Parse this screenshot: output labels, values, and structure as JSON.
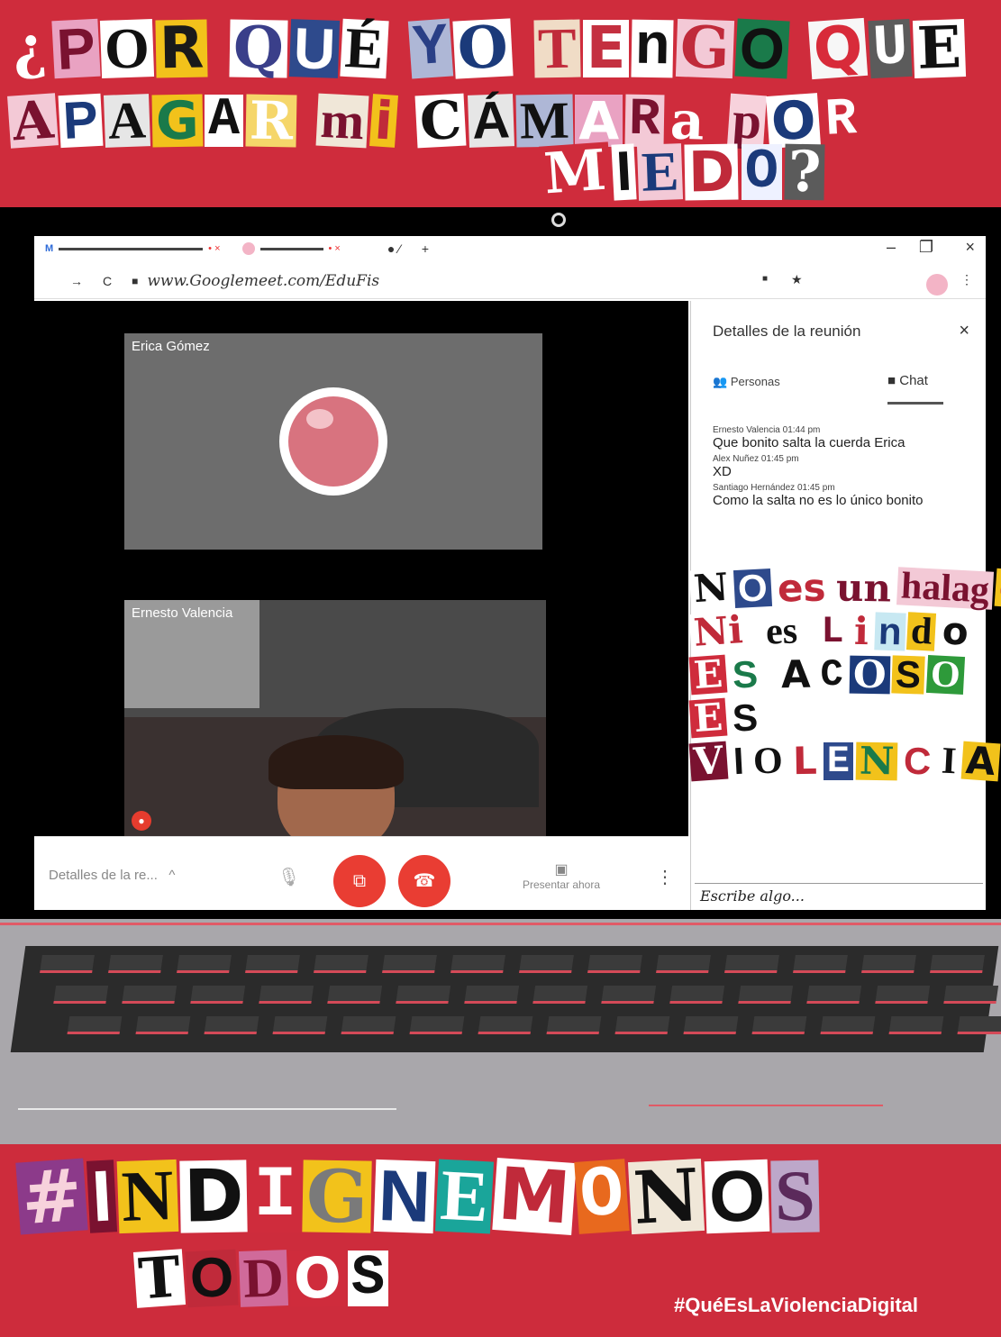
{
  "headline": {
    "line1": [
      {
        "t": "¿",
        "bg": "#cf2c3c",
        "fg": "#fff"
      },
      {
        "t": "P",
        "bg": "#e9a2c2",
        "fg": "#7a1230"
      },
      {
        "t": "O",
        "bg": "#fff",
        "fg": "#111"
      },
      {
        "t": "R",
        "bg": "#f2c21b",
        "fg": "#1a1a1a"
      },
      {
        "t": " "
      },
      {
        "t": "Q",
        "bg": "#fff",
        "fg": "#3a3f8a"
      },
      {
        "t": "U",
        "bg": "#2e4a8c",
        "fg": "#fff"
      },
      {
        "t": "É",
        "bg": "#fff",
        "fg": "#111"
      },
      {
        "t": " "
      },
      {
        "t": "Y",
        "bg": "#aeb7d6",
        "fg": "#2a3f86"
      },
      {
        "t": "O",
        "bg": "#fff",
        "fg": "#1b3a7a"
      },
      {
        "t": " "
      },
      {
        "t": "T",
        "bg": "#f0dcc6",
        "fg": "#c02a3a"
      },
      {
        "t": "E",
        "bg": "#fff",
        "fg": "#c43040"
      },
      {
        "t": "n",
        "bg": "#fff",
        "fg": "#111"
      },
      {
        "t": "G",
        "bg": "#f3c9d6",
        "fg": "#c02a3a"
      },
      {
        "t": "O",
        "bg": "#1a7a4a",
        "fg": "#111"
      },
      {
        "t": " "
      },
      {
        "t": "Q",
        "bg": "#f7f7f7",
        "fg": "#d82b3a"
      },
      {
        "t": "U",
        "bg": "#5b5b5b",
        "fg": "#fff"
      },
      {
        "t": "E",
        "bg": "#fff",
        "fg": "#111"
      }
    ],
    "line2": [
      {
        "t": "A",
        "bg": "#f3c9d6",
        "fg": "#7a1230"
      },
      {
        "t": "P",
        "bg": "#fff",
        "fg": "#1b3a7a"
      },
      {
        "t": "A",
        "bg": "#e6e6e6",
        "fg": "#111"
      },
      {
        "t": "G",
        "bg": "#f2c21b",
        "fg": "#1a7a4a"
      },
      {
        "t": "A",
        "bg": "#fff",
        "fg": "#111"
      },
      {
        "t": "R",
        "bg": "#f5d66a",
        "fg": "#fff"
      },
      {
        "t": " "
      },
      {
        "t": "m",
        "bg": "#f0e7d8",
        "fg": "#7a1230"
      },
      {
        "t": "i",
        "bg": "#f2c21b",
        "fg": "#c02a3a"
      },
      {
        "t": " "
      },
      {
        "t": "C",
        "bg": "#fff",
        "fg": "#111"
      },
      {
        "t": "Á",
        "bg": "#e6e6e6",
        "fg": "#111"
      },
      {
        "t": "M",
        "bg": "#aeb7d6",
        "fg": "#111"
      },
      {
        "t": "A",
        "bg": "#e9a2c2",
        "fg": "#fff"
      },
      {
        "t": "R",
        "bg": "#f3c9d6",
        "fg": "#7a1230"
      },
      {
        "t": "a",
        "bg": "#cf2c3c",
        "fg": "#fff"
      },
      {
        "t": " "
      },
      {
        "t": "p",
        "bg": "#f7d2dc",
        "fg": "#7a1230"
      },
      {
        "t": "O",
        "bg": "#fff",
        "fg": "#1b3a7a"
      },
      {
        "t": "R",
        "bg": "#cf2c3c",
        "fg": "#fff"
      }
    ],
    "line3": [
      {
        "t": "M",
        "bg": "#cf2c3c",
        "fg": "#fff"
      },
      {
        "t": "I",
        "bg": "#fff",
        "fg": "#111"
      },
      {
        "t": "E",
        "bg": "#f3c9d6",
        "fg": "#1b3a7a"
      },
      {
        "t": "D",
        "bg": "#fff",
        "fg": "#c02a3a"
      },
      {
        "t": "O",
        "bg": "#eef1ff",
        "fg": "#1b3a7a"
      },
      {
        "t": "?",
        "bg": "#5b5b5b",
        "fg": "#fff"
      }
    ]
  },
  "browser": {
    "tab1": "M",
    "url": "www.Googlemeet.com/EduFis",
    "controls": {
      "minimize": "–",
      "maximize": "❐",
      "close": "×"
    },
    "nav": {
      "forward": "→",
      "reload": "C",
      "lock": "🔒",
      "share": "■",
      "star": "★",
      "menu": "⋮"
    }
  },
  "meet": {
    "participants": [
      {
        "name": "Erica Gómez"
      },
      {
        "name": "Ernesto Valencia"
      }
    ],
    "controls": {
      "details": "Detalles de la re...",
      "details_caret": "^",
      "mic": "🎙",
      "camera": "⧉",
      "hangup": "☎",
      "present": "Presentar ahora",
      "more": "⋮"
    }
  },
  "panel": {
    "title": "Detalles de la reunión",
    "close": "×",
    "tab_people": "Personas",
    "tab_chat": "Chat",
    "messages": [
      {
        "meta": "Ernesto Valencia 01:44 pm",
        "text": "Que bonito salta la cuerda Erica"
      },
      {
        "meta": "Alex Nuñez  01:45 pm",
        "text": "XD"
      },
      {
        "meta": "Santiago Hernández  01:45 pm",
        "text": "Como la salta no es lo único bonito"
      }
    ],
    "input_placeholder": "Escribe algo..."
  },
  "ransom_chat": [
    [
      {
        "t": "N",
        "bg": "#fff",
        "fg": "#111"
      },
      {
        "t": "O",
        "bg": "#2e4a8c",
        "fg": "#fff"
      },
      {
        "t": " "
      },
      {
        "t": "es",
        "bg": "#fff",
        "fg": "#c02a3a"
      },
      {
        "t": " "
      },
      {
        "t": "un",
        "bg": "#fff",
        "fg": "#7a1230"
      },
      {
        "t": " "
      },
      {
        "t": "halag",
        "bg": "#f3c9d6",
        "fg": "#7a1230"
      },
      {
        "t": "o",
        "bg": "#f2c21b",
        "fg": "#c02a3a"
      }
    ],
    [
      {
        "t": "Ni",
        "bg": "#fff",
        "fg": "#c02a3a"
      },
      {
        "t": " "
      },
      {
        "t": "es",
        "bg": "#fff",
        "fg": "#111"
      },
      {
        "t": " "
      },
      {
        "t": "L",
        "bg": "#fff",
        "fg": "#7a1230"
      },
      {
        "t": "i",
        "bg": "#fff",
        "fg": "#c02a3a"
      },
      {
        "t": "n",
        "bg": "#c7e8f2",
        "fg": "#1b3a7a"
      },
      {
        "t": "d",
        "bg": "#f2c21b",
        "fg": "#111"
      },
      {
        "t": "o",
        "bg": "#fff",
        "fg": "#111"
      }
    ],
    [
      {
        "t": "E",
        "bg": "#cf2c3c",
        "fg": "#fff"
      },
      {
        "t": "S",
        "bg": "#fff",
        "fg": "#1a7a4a"
      },
      {
        "t": " "
      },
      {
        "t": "A",
        "bg": "#fff",
        "fg": "#111"
      },
      {
        "t": "C",
        "bg": "#fff",
        "fg": "#111"
      },
      {
        "t": "O",
        "bg": "#1b3a7a",
        "fg": "#fff"
      },
      {
        "t": "S",
        "bg": "#f2c21b",
        "fg": "#111"
      },
      {
        "t": "O",
        "bg": "#2e9a3a",
        "fg": "#fff"
      }
    ],
    [
      {
        "t": "E",
        "bg": "#cf2c3c",
        "fg": "#fff"
      },
      {
        "t": "S",
        "bg": "#fff",
        "fg": "#111"
      }
    ],
    [
      {
        "t": "V",
        "bg": "#7a1230",
        "fg": "#fff"
      },
      {
        "t": "I",
        "bg": "#fff",
        "fg": "#111"
      },
      {
        "t": "O",
        "bg": "#fff",
        "fg": "#111"
      },
      {
        "t": "L",
        "bg": "#fff",
        "fg": "#c02a3a"
      },
      {
        "t": "E",
        "bg": "#2e4a8c",
        "fg": "#fff"
      },
      {
        "t": "N",
        "bg": "#f2c21b",
        "fg": "#1a7a4a"
      },
      {
        "t": "C",
        "bg": "#fff",
        "fg": "#c02a3a"
      },
      {
        "t": "I",
        "bg": "#fff",
        "fg": "#111"
      },
      {
        "t": "A",
        "bg": "#f2c21b",
        "fg": "#111"
      }
    ]
  ],
  "bottom": {
    "line1": [
      {
        "t": "#",
        "bg": "#8c3a8a",
        "fg": "#f7d2dc"
      },
      {
        "t": "I",
        "bg": "#7a1230",
        "fg": "#fff"
      },
      {
        "t": "N",
        "bg": "#f2c21b",
        "fg": "#111"
      },
      {
        "t": "D",
        "bg": "#fff",
        "fg": "#111"
      },
      {
        "t": "I",
        "bg": "#cf2c3c",
        "fg": "#fff"
      },
      {
        "t": "G",
        "bg": "#f2c21b",
        "fg": "#7a7a7a"
      },
      {
        "t": "N",
        "bg": "#fff",
        "fg": "#1b3a7a"
      },
      {
        "t": "E",
        "bg": "#1aa59a",
        "fg": "#fff"
      },
      {
        "t": "M",
        "bg": "#fff",
        "fg": "#c02a3a"
      },
      {
        "t": "O",
        "bg": "#e8691e",
        "fg": "#fff"
      },
      {
        "t": "N",
        "bg": "#f0e7d8",
        "fg": "#111"
      },
      {
        "t": "O",
        "bg": "#fff",
        "fg": "#111"
      },
      {
        "t": "S",
        "bg": "#bda7c9",
        "fg": "#5b2a5b"
      }
    ],
    "line2": [
      {
        "t": "T",
        "bg": "#fff",
        "fg": "#111"
      },
      {
        "t": "O",
        "bg": "#c02a3a",
        "fg": "#111"
      },
      {
        "t": "D",
        "bg": "#d06a9a",
        "fg": "#7a1230"
      },
      {
        "t": "O",
        "bg": "#cf2c3c",
        "fg": "#fff"
      },
      {
        "t": "S",
        "bg": "#fff",
        "fg": "#111"
      }
    ],
    "hashtag": "#QuéEsLaViolenciaDigital"
  }
}
